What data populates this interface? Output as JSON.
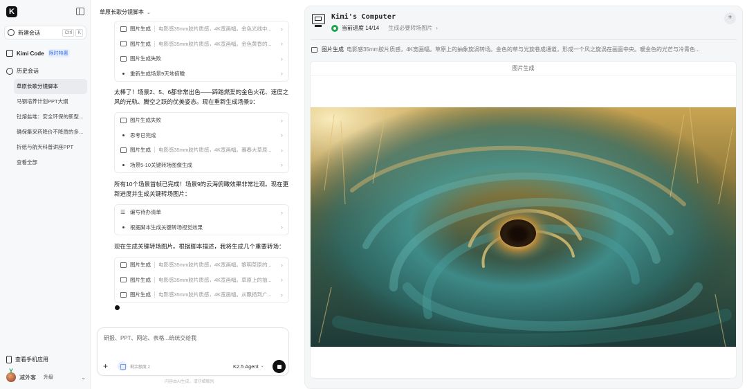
{
  "sidebar": {
    "logo": "K",
    "new_chat": {
      "label": "新建会话",
      "shortcut": [
        "Ctrl",
        "K"
      ]
    },
    "kimi_code": {
      "label": "Kimi Code",
      "badge": "限时特惠"
    },
    "history_label": "历史会话",
    "history": [
      "草原长歌分镜脚本",
      "马钢培养计划PPT大纲",
      "钍熔盐堆：安全环保的新型...",
      "确保集采药降价不降质的多...",
      "折纸与航天科普讲座PPT",
      "查看全部"
    ],
    "mobile_app": "查看手机应用",
    "user": {
      "name": "减外客",
      "upgrade": "升级"
    }
  },
  "chat": {
    "title": "草原长歌分镜脚本",
    "card1": [
      {
        "kind": "image",
        "name": "图片生成",
        "desc": "电影感35mm胶片质感，4K宽画幅。金色光线中..."
      },
      {
        "kind": "image",
        "name": "图片生成",
        "desc": "电影感35mm胶片质感，4K宽画幅。金色黄昏的..."
      },
      {
        "kind": "image",
        "name": "图片生成失败",
        "desc": ""
      },
      {
        "kind": "dot",
        "name": "重新生成场景9天地俯瞰",
        "desc": ""
      }
    ],
    "msg1": "太棒了！场景2、5、6都非常出色——蹄踏燃爱的金色火花、速度之风的光轨、腾空之跃的优美姿态。现在重新生成场景9：",
    "card2": [
      {
        "kind": "image",
        "name": "图片生成失败",
        "desc": ""
      },
      {
        "kind": "dot",
        "name": "思考已完成",
        "desc": ""
      },
      {
        "kind": "image",
        "name": "图片生成",
        "desc": "电影感35mm胶片质感，4K宽画幅。暮春大草原..."
      },
      {
        "kind": "dot",
        "name": "场景5-10关键转场图像生成",
        "desc": ""
      }
    ],
    "msg2": "所有10个场景首帧已完成！场景9的云海俯瞰效果非常壮观。现在更新进度并生成关键转场图片：",
    "card3": [
      {
        "kind": "list",
        "name": "编写待办清单",
        "desc": ""
      },
      {
        "kind": "dot",
        "name": "根据脚本生成关键转场视觉效果",
        "desc": ""
      }
    ],
    "msg3": "现在生成关键转场图片。根据脚本描述，我将生成几个重要转场：",
    "card4": [
      {
        "kind": "image",
        "name": "图片生成",
        "desc": "电影感35mm胶片质感，4K宽画幅。黎明草原的..."
      },
      {
        "kind": "image",
        "name": "图片生成",
        "desc": "电影感35mm胶片质感，4K宽画幅。草原上的抽..."
      },
      {
        "kind": "image",
        "name": "图片生成",
        "desc": "电影感35mm胶片质感，4K宽画幅。从飘扬到广..."
      }
    ],
    "input_placeholder": "研报、PPT、网站、表格...统统交给我",
    "tool_count": "剩余额度 2",
    "agent": "K2.5 Agent",
    "disclaimer": "内容由AI生成，请仔细甄别"
  },
  "computer": {
    "title": "Kimi's Computer",
    "progress_label": "当前进度 14/14",
    "step": "生成必要转场图片",
    "task": {
      "name": "图片生成",
      "desc": "电影感35mm胶片质感，4K宽画幅。草原上的抽象旋涡转场。金色的草与光旋卷成通道，形成一个风之旋涡在画面中央。暖金色的光芒与冷青色..."
    },
    "viewer_title": "图片生成"
  }
}
